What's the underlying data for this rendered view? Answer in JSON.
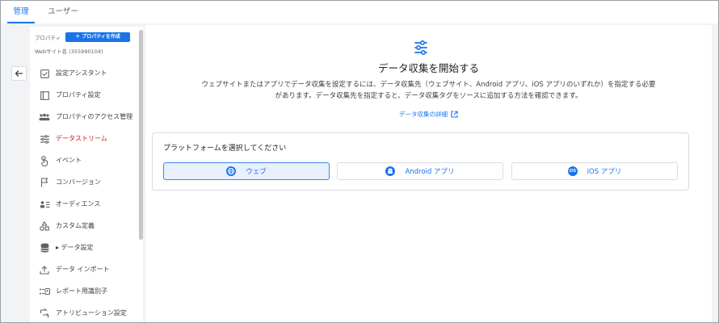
{
  "tabs": [
    {
      "label": "管理",
      "active": true
    },
    {
      "label": "ユーザー",
      "active": false
    }
  ],
  "sidebar": {
    "property_label": "プロパティ",
    "create_button": "＋ プロパティを作成",
    "web_name": "Webサイト名 (355990104)",
    "items": [
      {
        "label": "設定アシスタント",
        "icon": "checkbox-icon"
      },
      {
        "label": "プロパティ設定",
        "icon": "property-settings-icon"
      },
      {
        "label": "プロパティのアクセス管理",
        "icon": "people-icon"
      },
      {
        "label": "データストリーム",
        "icon": "data-stream-icon",
        "active": true
      },
      {
        "label": "イベント",
        "icon": "touch-icon"
      },
      {
        "label": "コンバージョン",
        "icon": "flag-icon"
      },
      {
        "label": "オーディエンス",
        "icon": "audience-icon"
      },
      {
        "label": "カスタム定義",
        "icon": "shapes-icon"
      },
      {
        "label": "▸ データ設定",
        "icon": "database-icon"
      },
      {
        "label": "データ インポート",
        "icon": "upload-icon"
      },
      {
        "label": "レポート用識別子",
        "icon": "identifier-icon"
      },
      {
        "label": "アトリビューション設定",
        "icon": "attribution-icon"
      }
    ]
  },
  "main": {
    "title": "データ収集を開始する",
    "description_line1": "ウェブサイトまたはアプリでデータ収集を設定するには、データ収集先（ウェブサイト、Android アプリ、iOS アプリのいずれか）を指定する必要",
    "description_line2": "があります。データ収集先を指定すると、データ収集タグをソースに追加する方法を確認できます。",
    "detail_link": "データ収集の詳細",
    "platform_heading": "プラットフォームを選択してください",
    "platforms": [
      {
        "label": "ウェブ",
        "icon": "globe-icon",
        "selected": true
      },
      {
        "label": "Android アプリ",
        "icon": "android-icon",
        "selected": false
      },
      {
        "label": "iOS アプリ",
        "icon": "ios-icon",
        "icon_text": "iOS",
        "selected": false
      }
    ]
  },
  "colors": {
    "accent": "#1a73e8",
    "active_nav": "#c5221f",
    "selected_bg": "#e8f0fe"
  }
}
